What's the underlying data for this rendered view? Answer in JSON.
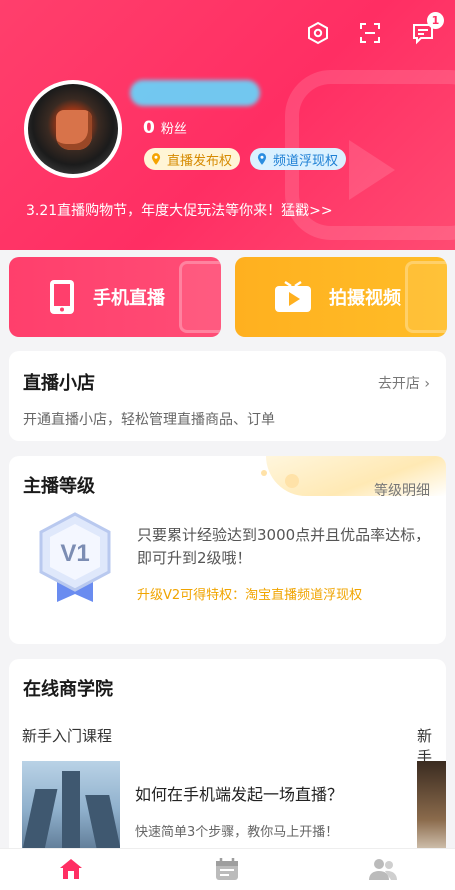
{
  "header": {
    "notifications_count": "1",
    "fans": {
      "count": "0",
      "label": "粉丝"
    },
    "badges": [
      {
        "label": "直播发布权"
      },
      {
        "label": "频道浮现权"
      }
    ],
    "promo": "3.21直播购物节，年度大促玩法等你来！猛戳>>"
  },
  "entries": {
    "live_label": "手机直播",
    "video_label": "拍摄视频"
  },
  "shop": {
    "title": "直播小店",
    "link": "去开店",
    "desc": "开通直播小店，轻松管理直播商品、订单"
  },
  "level": {
    "title": "主播等级",
    "link": "等级明细",
    "badge": "V1",
    "desc": "只要累计经验达到3000点并且优品率达标，即可升到2级哦！",
    "tip": "升级V2可得特权：淘宝直播频道浮现权"
  },
  "academy": {
    "title": "在线商学院",
    "tab_1": "新手入门课程",
    "tab_2": "新手",
    "course": {
      "title": "如何在手机端发起一场直播？",
      "desc": "快速简单3个步骤，教你马上开播！"
    }
  },
  "colors": {
    "primary": "#ff2e63",
    "accent": "#ffb01f",
    "badge_blue": "#1d7fd4",
    "badge_gold": "#d68a00"
  },
  "icons": [
    "settings-hexagon-icon",
    "scan-icon",
    "message-icon",
    "phone-icon",
    "video-camera-icon",
    "home-icon",
    "calendar-icon",
    "people-icon"
  ]
}
